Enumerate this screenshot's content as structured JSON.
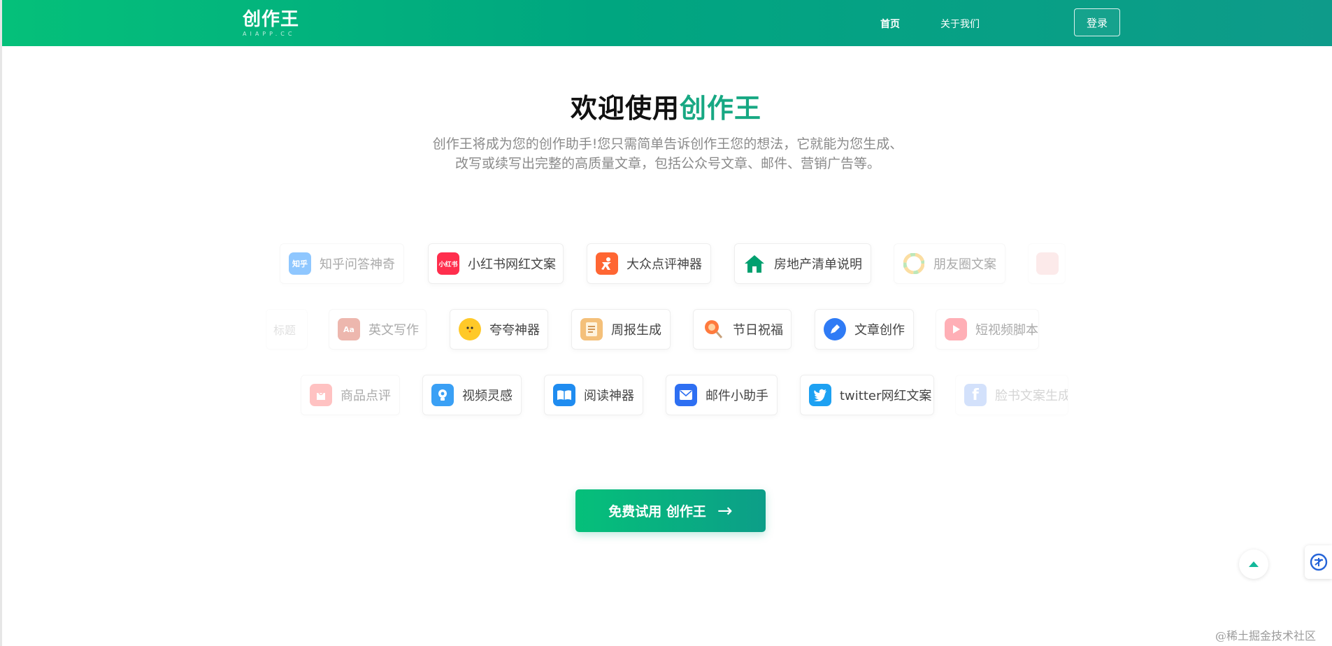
{
  "header": {
    "logo_text": "创作王",
    "logo_sub": "AIAPP.CC",
    "nav": [
      {
        "label": "首页"
      },
      {
        "label": "关于我们"
      }
    ],
    "login_label": "登录"
  },
  "hero": {
    "title_prefix": "欢迎使用",
    "title_brand": "创作王",
    "desc_line1": "创作王将成为您的创作助手!您只需简单告诉创作王您的想法，它就能为您生成、",
    "desc_line2": "改写或续写出完整的高质量文章，包括公众号文章、邮件、营销广告等。"
  },
  "rows": [
    [
      {
        "label": "知乎问答神奇",
        "icon": "zhihu-icon",
        "color": "#0a84ff"
      },
      {
        "label": "小红书网红文案",
        "icon": "xiaohongshu-icon",
        "color": "#ff2e4d"
      },
      {
        "label": "大众点评神器",
        "icon": "dianping-icon",
        "color": "#ff6633"
      },
      {
        "label": "房地产清单说明",
        "icon": "house-icon",
        "color": "#00a06f"
      },
      {
        "label": "朋友圈文案",
        "icon": "aperture-icon",
        "color": "#7bc96f"
      }
    ],
    [
      {
        "label": "英文写作",
        "icon": "book-icon",
        "color": "#d9614e"
      },
      {
        "label": "夸夸神器",
        "icon": "chick-icon",
        "color": "#ffc928"
      },
      {
        "label": "周报生成",
        "icon": "notepad-icon",
        "color": "#d58a3c"
      },
      {
        "label": "节日祝福",
        "icon": "lollipop-icon",
        "color": "#ff7a3d"
      },
      {
        "label": "文章创作",
        "icon": "pen-icon",
        "color": "#2f7bf5"
      },
      {
        "label": "短视频脚本",
        "icon": "play-icon",
        "color": "#ff4f5e"
      }
    ],
    [
      {
        "label": "商品点评",
        "icon": "bag-icon",
        "color": "#ff7a7a"
      },
      {
        "label": "视频灵感",
        "icon": "bulb-icon",
        "color": "#3aa0f5"
      },
      {
        "label": "阅读神器",
        "icon": "open-book-icon",
        "color": "#1f8cf0"
      },
      {
        "label": "邮件小助手",
        "icon": "mail-icon",
        "color": "#2e6ff2"
      },
      {
        "label": "twitter网红文案",
        "icon": "twitter-icon",
        "color": "#1da1f2"
      },
      {
        "label": "脸书文案生成",
        "icon": "facebook-icon",
        "color": "#3b7bf0"
      }
    ]
  ],
  "cta": {
    "label": "免费试用 创作王",
    "arrow": "→"
  },
  "watermark": "@稀土掘金技术社区",
  "colors": {
    "brand": "#00a680",
    "brand_light": "#05c07a"
  }
}
